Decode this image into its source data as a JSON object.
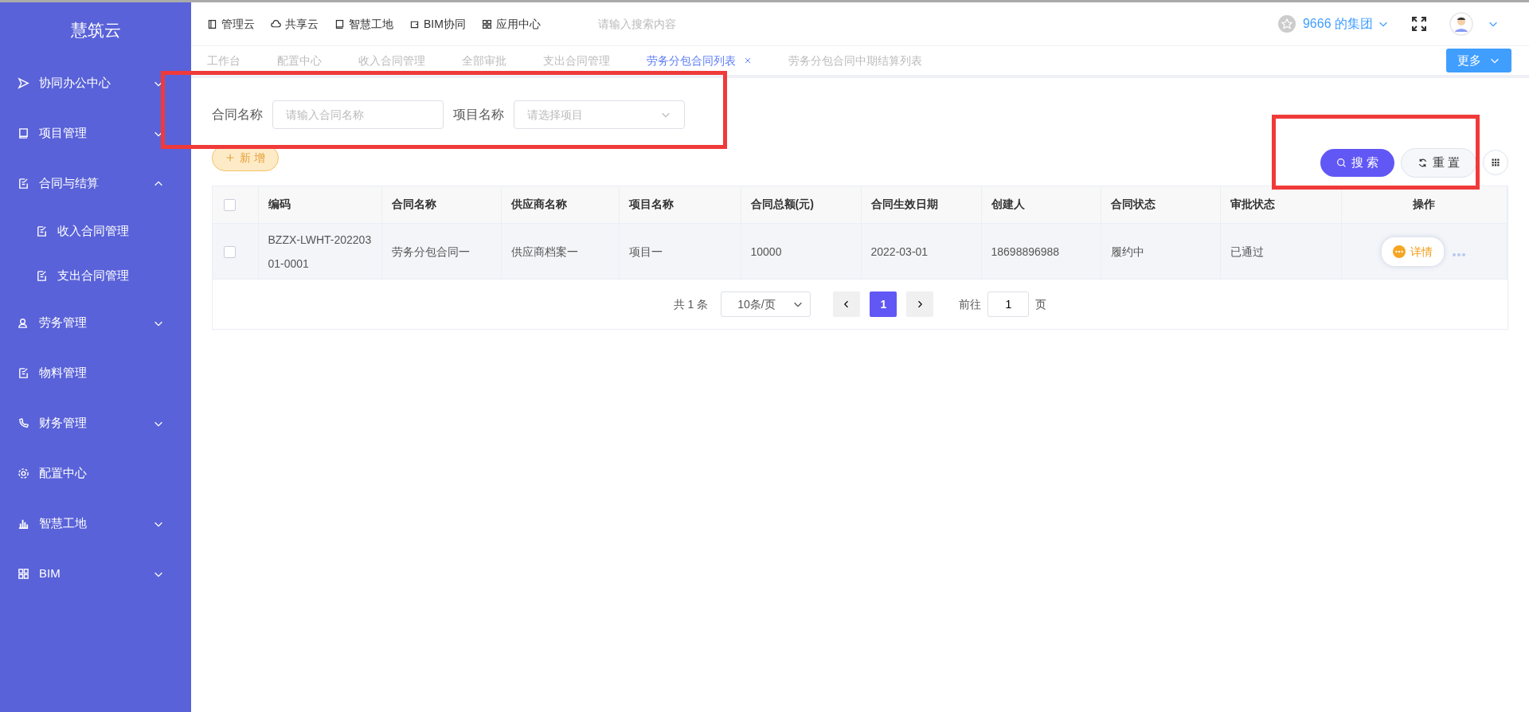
{
  "sidebar": {
    "logo": "慧筑云",
    "items": [
      {
        "label": "协同办公中心",
        "expanded": false
      },
      {
        "label": "项目管理",
        "expanded": false
      },
      {
        "label": "合同与结算",
        "expanded": true,
        "children": [
          {
            "label": "收入合同管理"
          },
          {
            "label": "支出合同管理"
          }
        ]
      },
      {
        "label": "劳务管理",
        "expanded": false
      },
      {
        "label": "物料管理"
      },
      {
        "label": "财务管理",
        "expanded": false
      },
      {
        "label": "配置中心"
      },
      {
        "label": "智慧工地",
        "expanded": false
      },
      {
        "label": "BIM",
        "expanded": false
      }
    ]
  },
  "top_nav": [
    {
      "label": "管理云"
    },
    {
      "label": "共享云"
    },
    {
      "label": "智慧工地"
    },
    {
      "label": "BIM协同"
    },
    {
      "label": "应用中心"
    }
  ],
  "search": {
    "placeholder": "请输入搜索内容"
  },
  "org": "9666 的集团",
  "tabs": [
    {
      "label": "工作台",
      "selected": false
    },
    {
      "label": "配置中心",
      "selected": false
    },
    {
      "label": "收入合同管理",
      "selected": false
    },
    {
      "label": "全部审批",
      "selected": false
    },
    {
      "label": "支出合同管理",
      "selected": false
    },
    {
      "label": "劳务分包合同列表",
      "selected": true
    },
    {
      "label": "劳务分包合同中期结算列表",
      "selected": false
    }
  ],
  "more_button": "更多",
  "filters": [
    {
      "kind": "input",
      "label": "合同名称",
      "placeholder": "请输入合同名称"
    },
    {
      "kind": "select",
      "label": "项目名称",
      "placeholder": "请选择项目"
    }
  ],
  "add_button": "新 增",
  "search_button": "搜 索",
  "reset_button": "重 置",
  "table": {
    "all_selected": false,
    "columns": [
      "编码",
      "合同名称",
      "供应商名称",
      "项目名称",
      "合同总额(元)",
      "合同生效日期",
      "创建人",
      "合同状态",
      "审批状态",
      "操作"
    ],
    "rows": [
      {
        "selected": false,
        "cells": [
          "BZZX-LWHT-20220301-0001",
          "劳务分包合同一",
          "供应商档案一",
          "项目一",
          "10000",
          "2022-03-01",
          "18698896988",
          "履约中",
          "已通过"
        ],
        "action": "详情"
      }
    ]
  },
  "pagination": {
    "total": "共 1 条",
    "page_size": "10条/页",
    "pages": [
      {
        "label": "1",
        "selected": true
      }
    ],
    "goto_label": "前往",
    "goto_value": "1",
    "goto_suffix": "页"
  }
}
